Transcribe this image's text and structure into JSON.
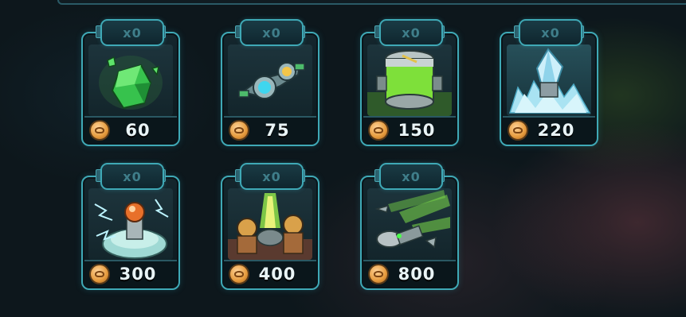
{
  "shop": {
    "items": [
      {
        "id": "crystal",
        "count": "x0",
        "price": "60",
        "icon": "green-crystal-icon"
      },
      {
        "id": "drone",
        "count": "x0",
        "price": "75",
        "icon": "drone-icon"
      },
      {
        "id": "canister",
        "count": "x0",
        "price": "150",
        "icon": "green-canister-icon"
      },
      {
        "id": "ice",
        "count": "x0",
        "price": "220",
        "icon": "ice-crystal-icon"
      },
      {
        "id": "tesla",
        "count": "x0",
        "price": "300",
        "icon": "tesla-orb-icon"
      },
      {
        "id": "reinforcements",
        "count": "x0",
        "price": "400",
        "icon": "soldiers-icon"
      },
      {
        "id": "missiles",
        "count": "x0",
        "price": "800",
        "icon": "missile-strike-icon"
      }
    ]
  },
  "colors": {
    "accent": "#3fa9b6",
    "coin": "#e59a3c",
    "text": "#e9f4f6"
  }
}
